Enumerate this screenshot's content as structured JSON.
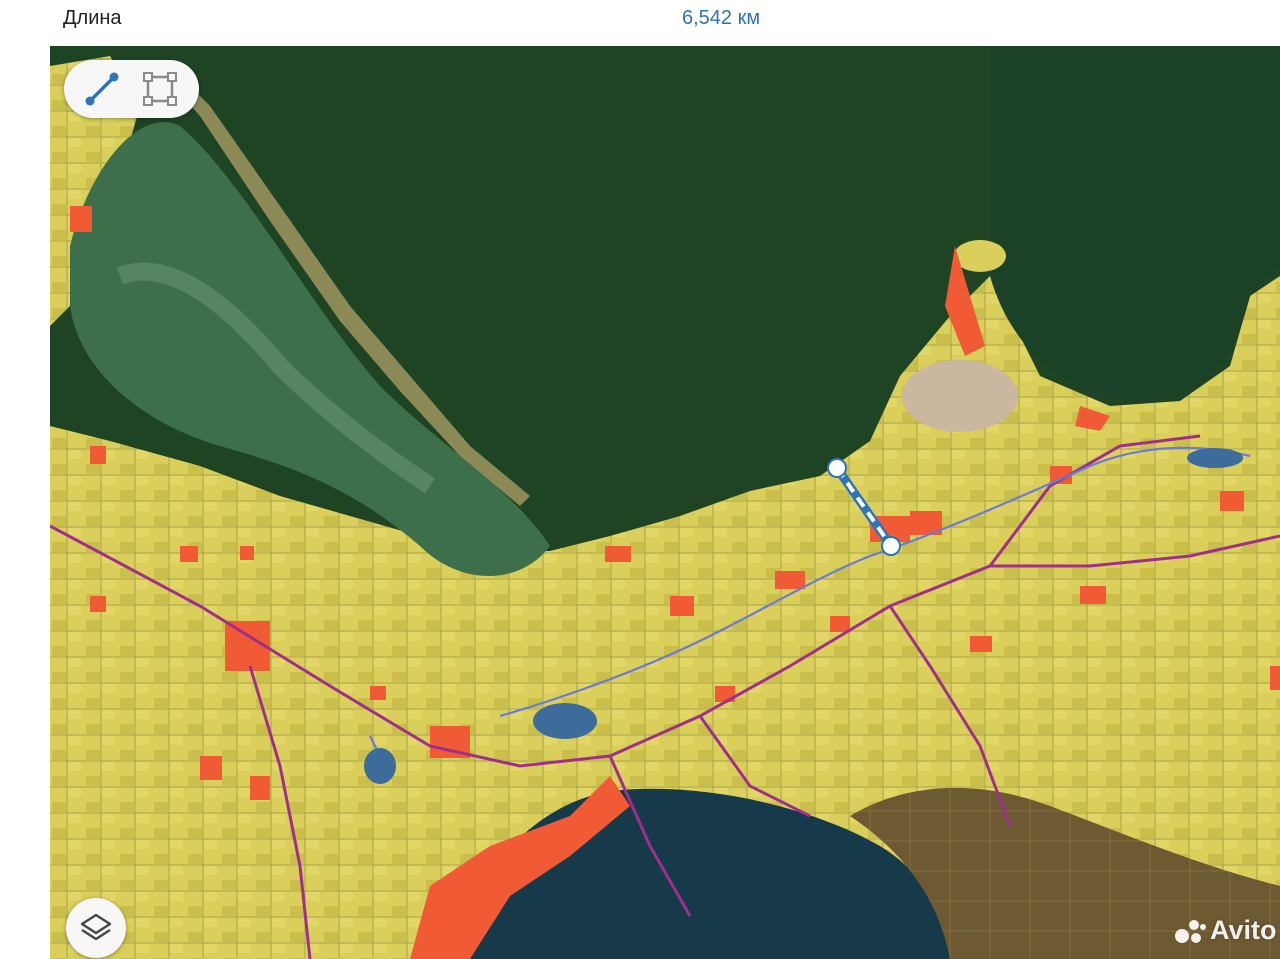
{
  "header": {
    "label": "Длина",
    "value": "6,542 км"
  },
  "toolbar": {
    "line_tool_icon": "ruler-line-icon",
    "area_tool_icon": "polygon-area-icon"
  },
  "layers": {
    "icon": "layers-icon"
  },
  "measurement": {
    "points": 2,
    "line_color": "#ffffff",
    "accent_color": "#2f73b8"
  },
  "map_colors": {
    "water": "#1f4a26",
    "fields": "#d9cf5a",
    "built_up": "#f05a35",
    "roads": "#a02f8c",
    "rivers": "#6a7ad8"
  },
  "watermark": {
    "text": "Avito"
  }
}
